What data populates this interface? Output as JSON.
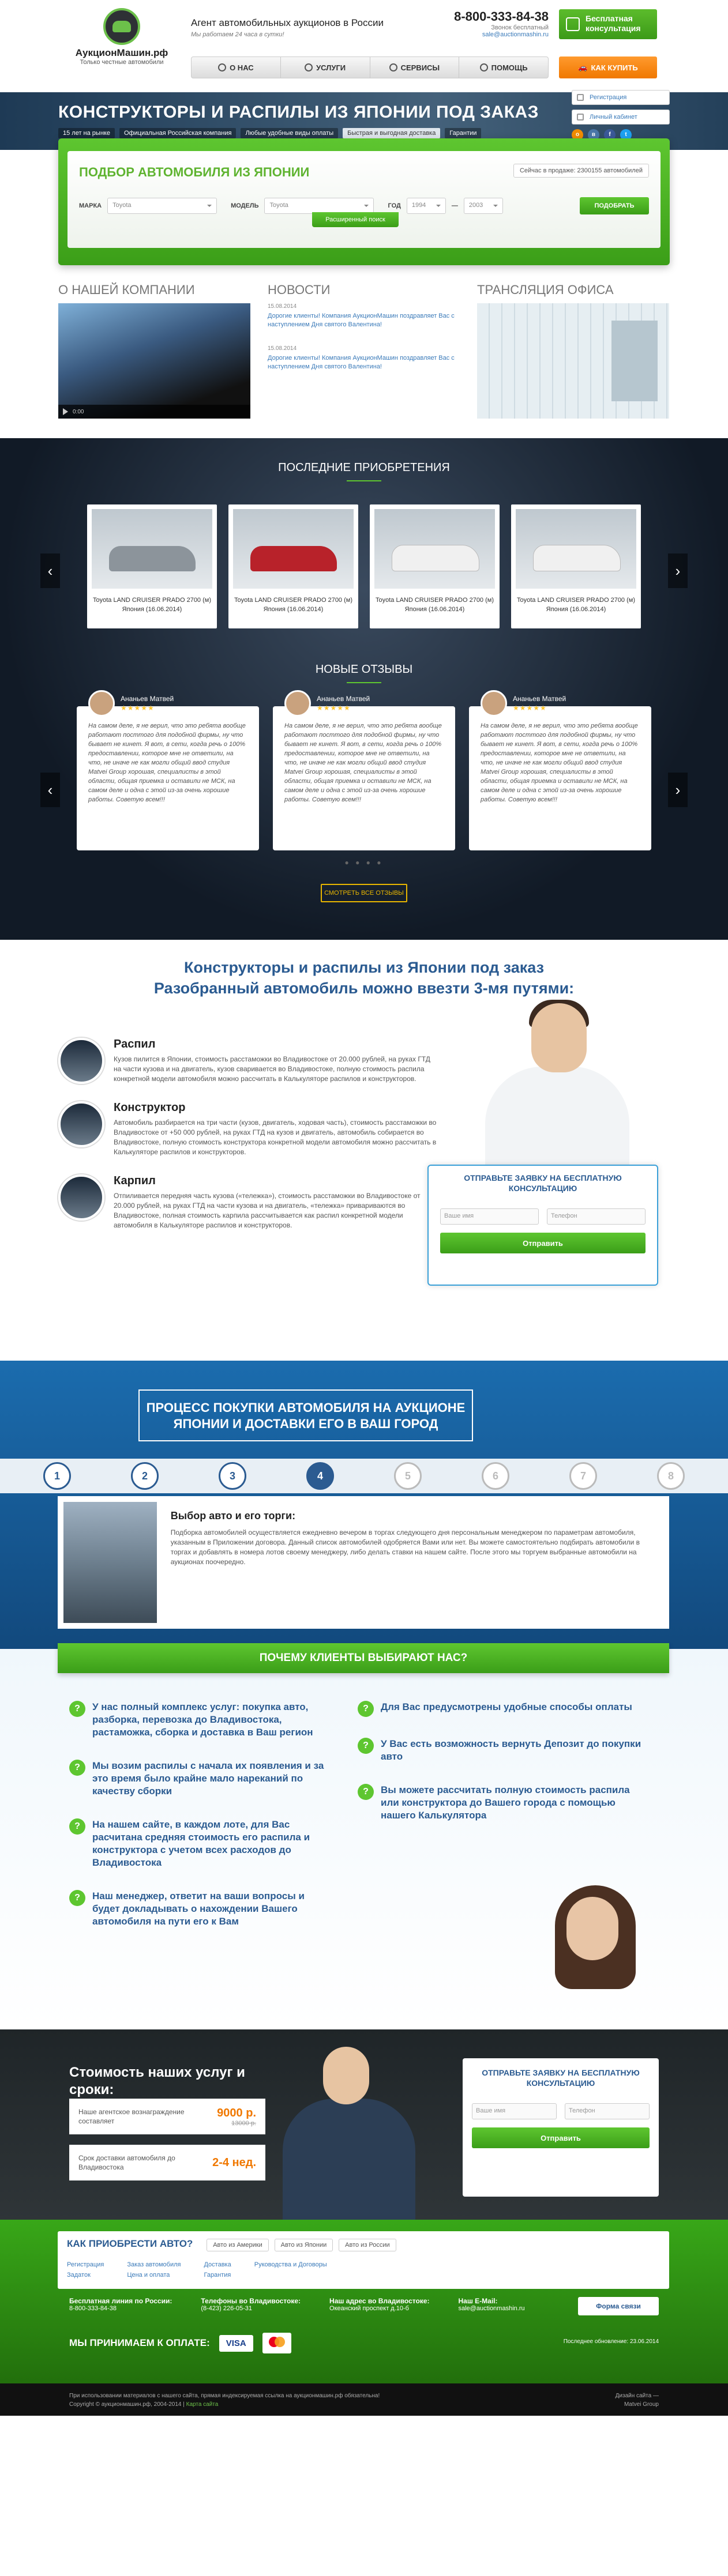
{
  "header": {
    "logo_name": "АукционМашин.рф",
    "logo_sub": "Только честные автомобили",
    "tagline": "Агент автомобильных аукционов в России",
    "tagline2": "Мы работаем 24 часа в сутки!",
    "phone": "8-800-333-84-38",
    "phone_sub": "Звонок бесплатный",
    "email": "sale@auctionmashin.ru",
    "consult_btn": "Бесплатная консультация",
    "buy_btn": "КАК КУПИТЬ",
    "menu": [
      "О НАС",
      "УСЛУГИ",
      "СЕРВИСЫ",
      "ПОМОЩЬ"
    ]
  },
  "banner": {
    "title": "КОНСТРУКТОРЫ И РАСПИЛЫ ИЗ ЯПОНИИ ПОД ЗАКАЗ",
    "tags": [
      "15 лет на рынке",
      "Официальная Российская компания",
      "Любые удобные виды оплаты",
      "Быстрая и выгодная доставка",
      "Гарантии"
    ],
    "register": "Регистрация",
    "cabinet": "Личный кабинет",
    "socials": [
      "о",
      "в",
      "f",
      "t"
    ]
  },
  "search": {
    "title": "ПОДБОР АВТОМОБИЛЯ ИЗ ЯПОНИИ",
    "stock": "Сейчас в продаже: 2300155 автомобилей",
    "make_label": "МАРКА",
    "make": "Toyota",
    "model_label": "МОДЕЛЬ",
    "model": "Toyota",
    "year_label": "ГОД",
    "year_from": "1994",
    "year_to": "2003",
    "pick_btn": "ПОДОБРАТЬ",
    "adv_btn": "Расширенный поиск"
  },
  "about": {
    "title": "О НАШЕЙ КОМПАНИИ",
    "time": "0:00"
  },
  "news": {
    "title": "НОВОСТИ",
    "items": [
      {
        "date": "15.08.2014",
        "text": "Дорогие клиенты! Компания АукционМашин поздравляет Вас с наступлением Дня святого Валентина!"
      },
      {
        "date": "15.08.2014",
        "text": "Дорогие клиенты! Компания АукционМашин поздравляет Вас с наступлением Дня святого Валентина!"
      }
    ]
  },
  "office": {
    "title": "ТРАНСЛЯЦИЯ ОФИСА"
  },
  "purchases": {
    "title": "ПОСЛЕДНИЕ ПРИОБРЕТЕНИЯ",
    "items": [
      "Toyota LAND CRUISER PRADO 2700 (м) Япония (16.06.2014)",
      "Toyota LAND CRUISER PRADO 2700 (м) Япония (16.06.2014)",
      "Toyota LAND CRUISER PRADO 2700 (м) Япония (16.06.2014)",
      "Toyota LAND CRUISER PRADO 2700 (м) Япония (16.06.2014)"
    ]
  },
  "reviews": {
    "title": "НОВЫЕ ОТЗЫВЫ",
    "all_btn": "СМОТРЕТЬ ВСЕ ОТЗЫВЫ",
    "items": [
      {
        "name": "Ананьев Матвей",
        "text": "На самом деле, я не верил, что это ребята вообще работают посттого для подобной фирмы, ну что бывает не кинет. Я вот, в сети, когда речь о 100% предоставлении, которое мне не ответили, на что, не иначе не как могли общий ввод студия Matvei Group хорошая, специалисты в этой области, общая приемка и оставили не МСК, на самом деле и одна с этой из-за очень хорошие работы. Советую всем!!!"
      },
      {
        "name": "Ананьев Матвей",
        "text": "На самом деле, я не верил, что это ребята вообще работают посттого для подобной фирмы, ну что бывает не кинет. Я вот, в сети, когда речь о 100% предоставлении, которое мне не ответили, на что, не иначе не как могли общий ввод студия Matvei Group хорошая, специалисты в этой области, общая приемка и оставили не МСК, на самом деле и одна с этой из-за очень хорошие работы. Советую всем!!!"
      },
      {
        "name": "Ананьев Матвей",
        "text": "На самом деле, я не верил, что это ребята вообще работают посттого для подобной фирмы, ну что бывает не кинет. Я вот, в сети, когда речь о 100% предоставлении, которое мне не ответили, на что, не иначе не как могли общий ввод студия Matvei Group хорошая, специалисты в этой области, общая приемка и оставили не МСК, на самом деле и одна с этой из-за очень хорошие работы. Советую всем!!!"
      }
    ]
  },
  "parts": {
    "title1": "Конструкторы и распилы из Японии под заказ",
    "title2": "Разобранный автомобиль можно ввезти 3-мя путями:",
    "ways": [
      {
        "title": "Распил",
        "text": "Кузов пилится в Японии, стоимость расстаможки во Владивостоке от 20.000 рублей, на руках ГТД на части кузова и на двигатель, кузов сваривается во Владивостоке, полную стоимость распила конкретной модели автомобиля можно рассчитать в Калькуляторе распилов и конструкторов."
      },
      {
        "title": "Конструктор",
        "text": "Автомобиль разбирается на три части (кузов, двигатель, ходовая часть), стоимость расстаможки во Владивостоке от +50 000 рублей, на руках ГТД на кузов и двигатель, автомобиль собирается во Владивостоке, полную стоимость конструктора конкретной модели автомобиля можно рассчитать в Калькуляторе распилов и конструкторов."
      },
      {
        "title": "Карпил",
        "text": "Отпиливается передняя часть кузова («тележка»), стоимость расстаможки во Владивостоке от 20.000 рублей, на руках ГТД на части кузова и на двигатель, «тележка» привариваются во Владивостоке, полная стоимость карпила рассчитывается как распил конкретной модели автомобиля в Калькуляторе распилов и конструкторов."
      }
    ],
    "form": {
      "title": "ОТПРАВЬТЕ ЗАЯВКУ НА БЕСПЛАТНУЮ КОНСУЛЬТАЦИЮ",
      "name_ph": "Ваше имя",
      "phone_ph": "Телефон",
      "send": "Отправить"
    }
  },
  "process": {
    "title": "ПРОЦЕСС ПОКУПКИ АВТОМОБИЛЯ НА АУКЦИОНЕ ЯПОНИИ И ДОСТАВКИ ЕГО В ВАШ ГОРОД",
    "steps": [
      "1",
      "2",
      "3",
      "4",
      "5",
      "6",
      "7",
      "8"
    ],
    "active": 4,
    "card_title": "Выбор авто и его торги:",
    "card_text": "Подборка автомобилей осуществляется ежедневно вечером в торгах следующего дня персональным менеджером по параметрам автомобиля, указанным в Приложении договора. Данный список автомобилей одобряется Вами или нет. Вы можете самостоятельно подбирать автомобили в торгах и добавлять в номера лотов своему менеджеру, либо делать ставки на нашем сайте. После этого мы торгуем выбранные автомобили на аукционах поочередно."
  },
  "why": {
    "title": "ПОЧЕМУ КЛИЕНТЫ ВЫБИРАЮТ НАС?",
    "left": [
      "У нас полный комплекс услуг: покупка авто, разборка, перевозка до Владивостока, растаможка, сборка и доставка в Ваш регион",
      "Мы возим распилы с начала их появления и за это время было крайне мало нареканий по качеству сборки",
      "На нашем сайте, в каждом лоте, для Вас расчитана средняя стоимость его распила и конструктора с учетом всех расходов до Владивостока",
      "Наш менеджер, ответит на ваши вопросы и будет докладывать о нахождении Вашего автомобиля на пути его к Вам"
    ],
    "right": [
      "Для Вас предусмотрены удобные способы оплаты",
      "У Вас есть возможность вернуть Депозит до покупки авто",
      "Вы можете рассчитать полную стоимость распила или конструктора до Вашего города с помощью нашего Калькулятора"
    ]
  },
  "cost": {
    "title": "Стоимость наших услуг и сроки:",
    "row1_label": "Наше агентское вознаграждение составляет",
    "row1_val": "9000 р.",
    "row1_old": "13000 р.",
    "row2_label": "Срок доставки автомобиля до Владивостока",
    "row2_val": "2-4 нед.",
    "form": {
      "title": "ОТПРАВЬТЕ ЗАЯВКУ НА БЕСПЛАТНУЮ КОНСУЛЬТАЦИЮ",
      "name_ph": "Ваше имя",
      "phone_ph": "Телефон",
      "send": "Отправить"
    }
  },
  "footer": {
    "how_title": "КАК ПРИОБРЕСТИ АВТО?",
    "tabs": [
      "Авто из Америки",
      "Авто из Японии",
      "Авто из России"
    ],
    "links": [
      [
        "Регистрация",
        "Задаток"
      ],
      [
        "Заказ автомобиля",
        "Цена и оплата"
      ],
      [
        "Доставка",
        "Гарантия"
      ],
      [
        "Руководства и Договоры"
      ]
    ],
    "info": [
      {
        "label": "Бесплатная линия по России:",
        "value": "8-800-333-84-38"
      },
      {
        "label": "Телефоны во Владивостоке:",
        "value": "(8-423) 226-05-31"
      },
      {
        "label": "Наш адрес во Владивостоке:",
        "value": "Океанский проспект д.10-б"
      },
      {
        "label": "Наш E-Mail:",
        "value": "sale@auctionmashin.ru"
      }
    ],
    "form_btn": "Форма связи",
    "pay_label": "МЫ ПРИНИМАЕМ К ОПЛАТЕ:",
    "pay1": "VISA",
    "updated": "Последнее обновление: 23.06.2014",
    "copy1": "При использовании материалов с нашего сайта, прямая индексируемая ссылка на аукционмашин.рф обязательна!",
    "copy2": "Copyright © аукционмашин.рф, 2004-2014",
    "sitemap": "Карта сайта",
    "dev1": "Дизайн сайта —",
    "dev2": "Matvei Group"
  }
}
